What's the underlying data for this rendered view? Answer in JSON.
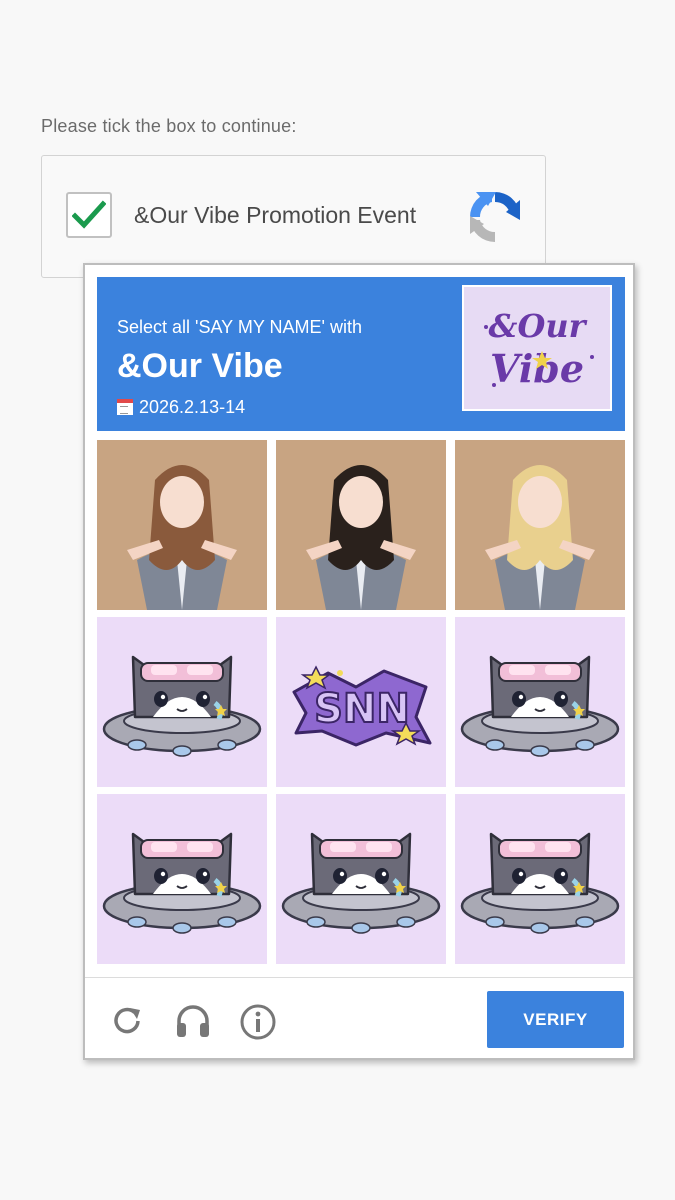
{
  "prompt": "Please tick the box to continue:",
  "checkbox": {
    "label": "&Our Vibe Promotion Event",
    "checked": true
  },
  "challenge": {
    "instruction": "Select all 'SAY MY NAME' with",
    "title": "&Our Vibe",
    "date": "2026.2.13-14",
    "logo_text_top": "&Our",
    "logo_text_bottom": "Vibe",
    "tiles": [
      {
        "kind": "photo",
        "hair": "#8a5a3c"
      },
      {
        "kind": "photo",
        "hair": "#2a211c"
      },
      {
        "kind": "photo",
        "hair": "#e9d08e"
      },
      {
        "kind": "cat-ufo"
      },
      {
        "kind": "snn-logo",
        "text": "SNN"
      },
      {
        "kind": "cat-ufo"
      },
      {
        "kind": "cat-ufo"
      },
      {
        "kind": "cat-ufo"
      },
      {
        "kind": "cat-ufo"
      }
    ],
    "verify_label": "VERIFY",
    "footer_icons": [
      "refresh-icon",
      "headphones-icon",
      "info-icon"
    ]
  },
  "colors": {
    "accent": "#3b82dd",
    "check": "#1a9a4d",
    "tile_bg": "#ecdcf8"
  }
}
